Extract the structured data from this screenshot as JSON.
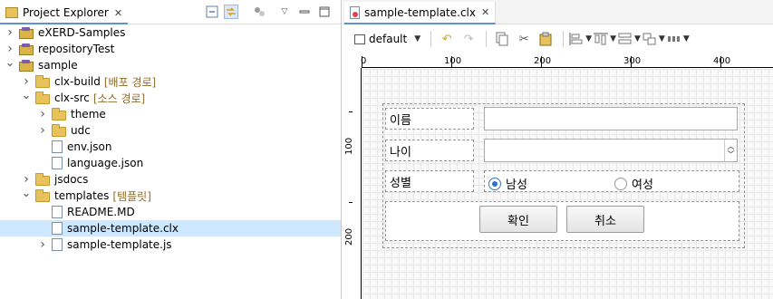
{
  "explorer": {
    "title": "Project Explorer",
    "close": "✕",
    "icons": [
      "collapse-all-icon",
      "link-with-editor-icon",
      "filter-icon",
      "view-menu-icon",
      "minimize-icon",
      "maximize-icon"
    ],
    "items": [
      {
        "label": "eXERD-Samples",
        "decor": "",
        "expanded": false,
        "icon": "project",
        "depth": 0
      },
      {
        "label": "repositoryTest",
        "decor": "",
        "expanded": false,
        "icon": "project",
        "depth": 0
      },
      {
        "label": "sample",
        "decor": "",
        "expanded": true,
        "icon": "project",
        "depth": 0
      },
      {
        "label": "clx-build",
        "decor": "[배포 경로]",
        "expanded": false,
        "icon": "folder",
        "depth": 1
      },
      {
        "label": "clx-src",
        "decor": "[소스 경로]",
        "expanded": true,
        "icon": "folder",
        "depth": 1
      },
      {
        "label": "theme",
        "decor": "",
        "expanded": false,
        "icon": "folder",
        "depth": 2
      },
      {
        "label": "udc",
        "decor": "",
        "expanded": false,
        "icon": "folder",
        "depth": 2
      },
      {
        "label": "env.json",
        "decor": "",
        "expanded": null,
        "icon": "file",
        "depth": 2
      },
      {
        "label": "language.json",
        "decor": "",
        "expanded": null,
        "icon": "file",
        "depth": 2
      },
      {
        "label": "jsdocs",
        "decor": "",
        "expanded": false,
        "icon": "folder",
        "depth": 1
      },
      {
        "label": "templates",
        "decor": "[템플릿]",
        "expanded": true,
        "icon": "folder",
        "depth": 1
      },
      {
        "label": "README.MD",
        "decor": "",
        "expanded": null,
        "icon": "file",
        "depth": 2
      },
      {
        "label": "sample-template.clx",
        "decor": "",
        "expanded": null,
        "icon": "file",
        "depth": 2,
        "selected": true
      },
      {
        "label": "sample-template.js",
        "decor": "",
        "expanded": false,
        "icon": "file",
        "depth": 2
      }
    ]
  },
  "editor": {
    "tab": "sample-template.clx",
    "close": "✕",
    "toolbar": {
      "layout_value": "default"
    },
    "ruler": {
      "top": [
        "0",
        "100",
        "200",
        "300",
        "400"
      ],
      "left": [
        "100",
        "200"
      ]
    },
    "form": {
      "name_label": "이름",
      "name_value": "",
      "age_label": "나이",
      "age_value": "",
      "gender_label": "성별",
      "radio_male": "남성",
      "radio_female": "여성",
      "selected": "남성",
      "ok_button": "확인",
      "cancel_button": "취소"
    }
  },
  "colors": {
    "selection": "#cde8ff",
    "tab_accent": "#5b93d6",
    "radio_on": "#2e6fd1",
    "decoration": "#8c6a2c"
  }
}
